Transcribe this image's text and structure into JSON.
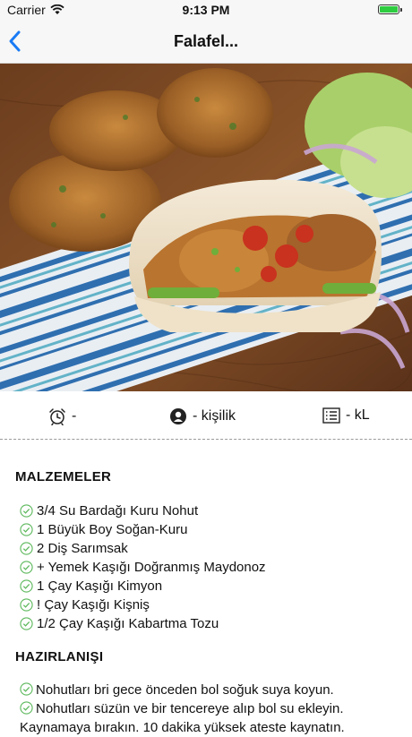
{
  "status_bar": {
    "carrier": "Carrier",
    "time": "9:13 PM",
    "battery_level": 1.0,
    "battery_color": "#2ecc40"
  },
  "nav": {
    "title": "Falafel...",
    "back_icon": "chevron-left-icon",
    "accent": "#1a7bf5"
  },
  "hero": {
    "icon": "falafel-pita-photo"
  },
  "info": {
    "time_text": "-",
    "people_text": "- kişilik",
    "calories_text": "- kL"
  },
  "ingredients": {
    "title": "MALZEMELER",
    "items": [
      "3/4 Su Bardağı Kuru Nohut",
      "1 Büyük Boy Soğan-Kuru",
      "2 Diş Sarımsak",
      "+ Yemek Kaşığı Doğranmış Maydonoz",
      "1 Çay Kaşığı Kimyon",
      "! Çay Kaşığı Kişniş",
      "1/2 Çay Kaşığı Kabartma Tozu"
    ]
  },
  "preparation": {
    "title": "HAZIRLANIŞI",
    "steps": [
      "Nohutları bri gece önceden bol soğuk suya koyun.",
      "Nohutları süzün ve bir tencereye alıp bol su ekleyin. Kaynamaya bırakın. 10 dakika yüksek ateste kaynatın."
    ]
  },
  "check_color": "#5cb85c"
}
